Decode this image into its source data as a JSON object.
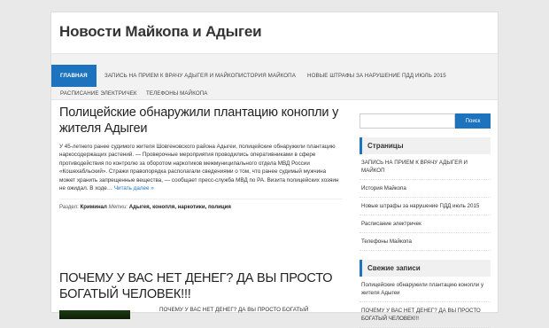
{
  "site": {
    "title": "Новости Майкопа и Адыгеи"
  },
  "nav": {
    "items": [
      {
        "label": "Главная"
      },
      {
        "label": "Запись на прием к врачу Адыгея и Майкоп"
      },
      {
        "label": "История Майкопа"
      },
      {
        "label": "Новые штрафы за нарушение ПДД июль 2015"
      },
      {
        "label": "Расписание электричек"
      },
      {
        "label": "Телефоны Майкопа"
      }
    ]
  },
  "post1": {
    "title": "Полицейские обнаружили плантацию конопли у жителя Адыгеи",
    "excerpt": "У 45-летнего ранее судимого жителя Шовгеновского района Адыгеи, полицейские обнаружили плантацию наркосодержащих растений. — Проверочные мероприятия проводились оперативниками в сфере противодействия по контролю за оборотом наркотиков межмуниципального отдела МВД России «Кошехабльский». Стражи правопорядка располагали сведениями о том, что ранее судимый мужчина может хранить запрещенные вещества, — сообщает пресс-служба МВД по РА. Визита полицейских хозяин не ожидал. В ходе… ",
    "read_more": "Читать далее »",
    "section_label": "Раздел:",
    "section": "Криминал",
    "tags_label": "Метки:",
    "tags": "Адыгея, конопля, наркотики, полиция"
  },
  "post2": {
    "title": "ПОЧЕМУ У ВАС НЕТ ДЕНЕГ? ДА ВЫ ПРОСТО БОГАТЫЙ ЧЕЛОВЕК!!!",
    "snippet": "ПОЧЕМУ У ВАС НЕТ ДЕНЕГ? ДА ВЫ ПРОСТО БОГАТЫЙ"
  },
  "sidebar": {
    "search_button": "Поиск",
    "pages_title": "Страницы",
    "pages": [
      "ЗАПИСЬ НА ПРИЕМ К ВРАЧУ АДЫГЕЯ И МАЙКОП",
      "История Майкопа",
      "Новые штрафы за нарушение ПДД июль 2015",
      "Расписание электричек",
      "Телефоны Майкопа"
    ],
    "recent_title": "Свежие записи",
    "recent": [
      "Полицейские обнаружили плантацию конопли у жителя Адыгеи",
      "ПОЧЕМУ У ВАС НЕТ ДЕНЕГ? ДА ВЫ ПРОСТО БОГАТЫЙ ЧЕЛОВЕК!!!"
    ]
  },
  "colors": {
    "accent": "#1e73be",
    "background": "#e9e9e9"
  }
}
